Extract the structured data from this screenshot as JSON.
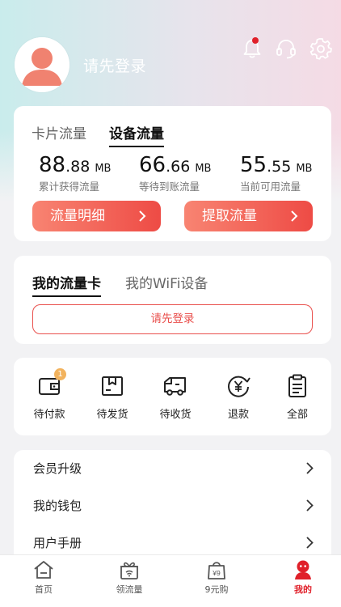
{
  "header": {
    "login_prompt": "请先登录",
    "notification_dot": true
  },
  "flow_card": {
    "tabs": [
      {
        "label": "卡片流量",
        "active": false
      },
      {
        "label": "设备流量",
        "active": true
      }
    ],
    "stats": [
      {
        "int": "88",
        "dec": ".88",
        "unit": "MB",
        "label": "累计获得流量"
      },
      {
        "int": "66",
        "dec": ".66",
        "unit": "MB",
        "label": "等待到账流量"
      },
      {
        "int": "55",
        "dec": ".55",
        "unit": "MB",
        "label": "当前可用流量"
      }
    ],
    "detail_button": "流量明细",
    "withdraw_button": "提取流量"
  },
  "my_card": {
    "tabs": [
      {
        "label": "我的流量卡",
        "active": true
      },
      {
        "label": "我的WiFi设备",
        "active": false
      }
    ],
    "login_button": "请先登录"
  },
  "orders": {
    "items": [
      {
        "label": "待付款",
        "icon": "wallet-icon",
        "badge": "1"
      },
      {
        "label": "待发货",
        "icon": "box-icon"
      },
      {
        "label": "待收货",
        "icon": "truck-icon"
      },
      {
        "label": "退款",
        "icon": "refund-icon"
      },
      {
        "label": "全部",
        "icon": "clipboard-icon"
      }
    ]
  },
  "menu": {
    "items": [
      {
        "label": "会员升级"
      },
      {
        "label": "我的钱包"
      },
      {
        "label": "用户手册"
      }
    ]
  },
  "tabbar": {
    "items": [
      {
        "label": "首页",
        "icon": "home-icon",
        "active": false
      },
      {
        "label": "领流量",
        "icon": "gift-icon",
        "active": false
      },
      {
        "label": "9元购",
        "icon": "shopping-bag-icon",
        "bag_text": "¥9",
        "active": false
      },
      {
        "label": "我的",
        "icon": "profile-icon",
        "active": true
      }
    ]
  },
  "colors": {
    "accent": "#e9504d",
    "button_gradient_start": "#f88472",
    "button_gradient_end": "#ee4b45",
    "active_tab": "#e0202a",
    "badge": "#f2b35e"
  }
}
